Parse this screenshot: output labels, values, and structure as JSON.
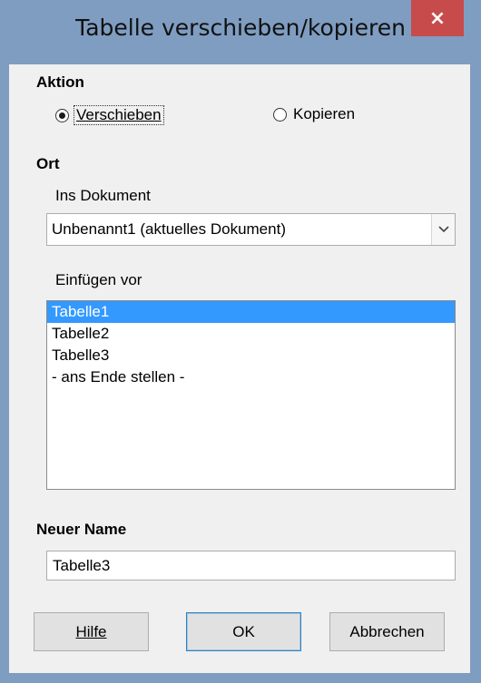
{
  "window": {
    "title": "Tabelle verschieben/kopieren",
    "close_glyph": "×"
  },
  "action": {
    "heading": "Aktion",
    "move_label": "Verschieben",
    "copy_label": "Kopieren",
    "selected": "move"
  },
  "location": {
    "heading": "Ort",
    "document_label": "Ins Dokument",
    "document_value": "Unbenannt1 (aktuelles Dokument)",
    "insert_before_label": "Einfügen vor",
    "sheets": [
      "Tabelle1",
      "Tabelle2",
      "Tabelle3",
      "- ans Ende stellen -"
    ],
    "selected_index": 0
  },
  "new_name": {
    "heading": "Neuer Name",
    "value": "Tabelle3"
  },
  "buttons": {
    "help": "Hilfe",
    "ok": "OK",
    "cancel": "Abbrechen"
  },
  "colors": {
    "titlebar": "#7f9dc1",
    "close": "#c74b4b",
    "selection": "#3399ff",
    "client": "#f0f0f0"
  }
}
